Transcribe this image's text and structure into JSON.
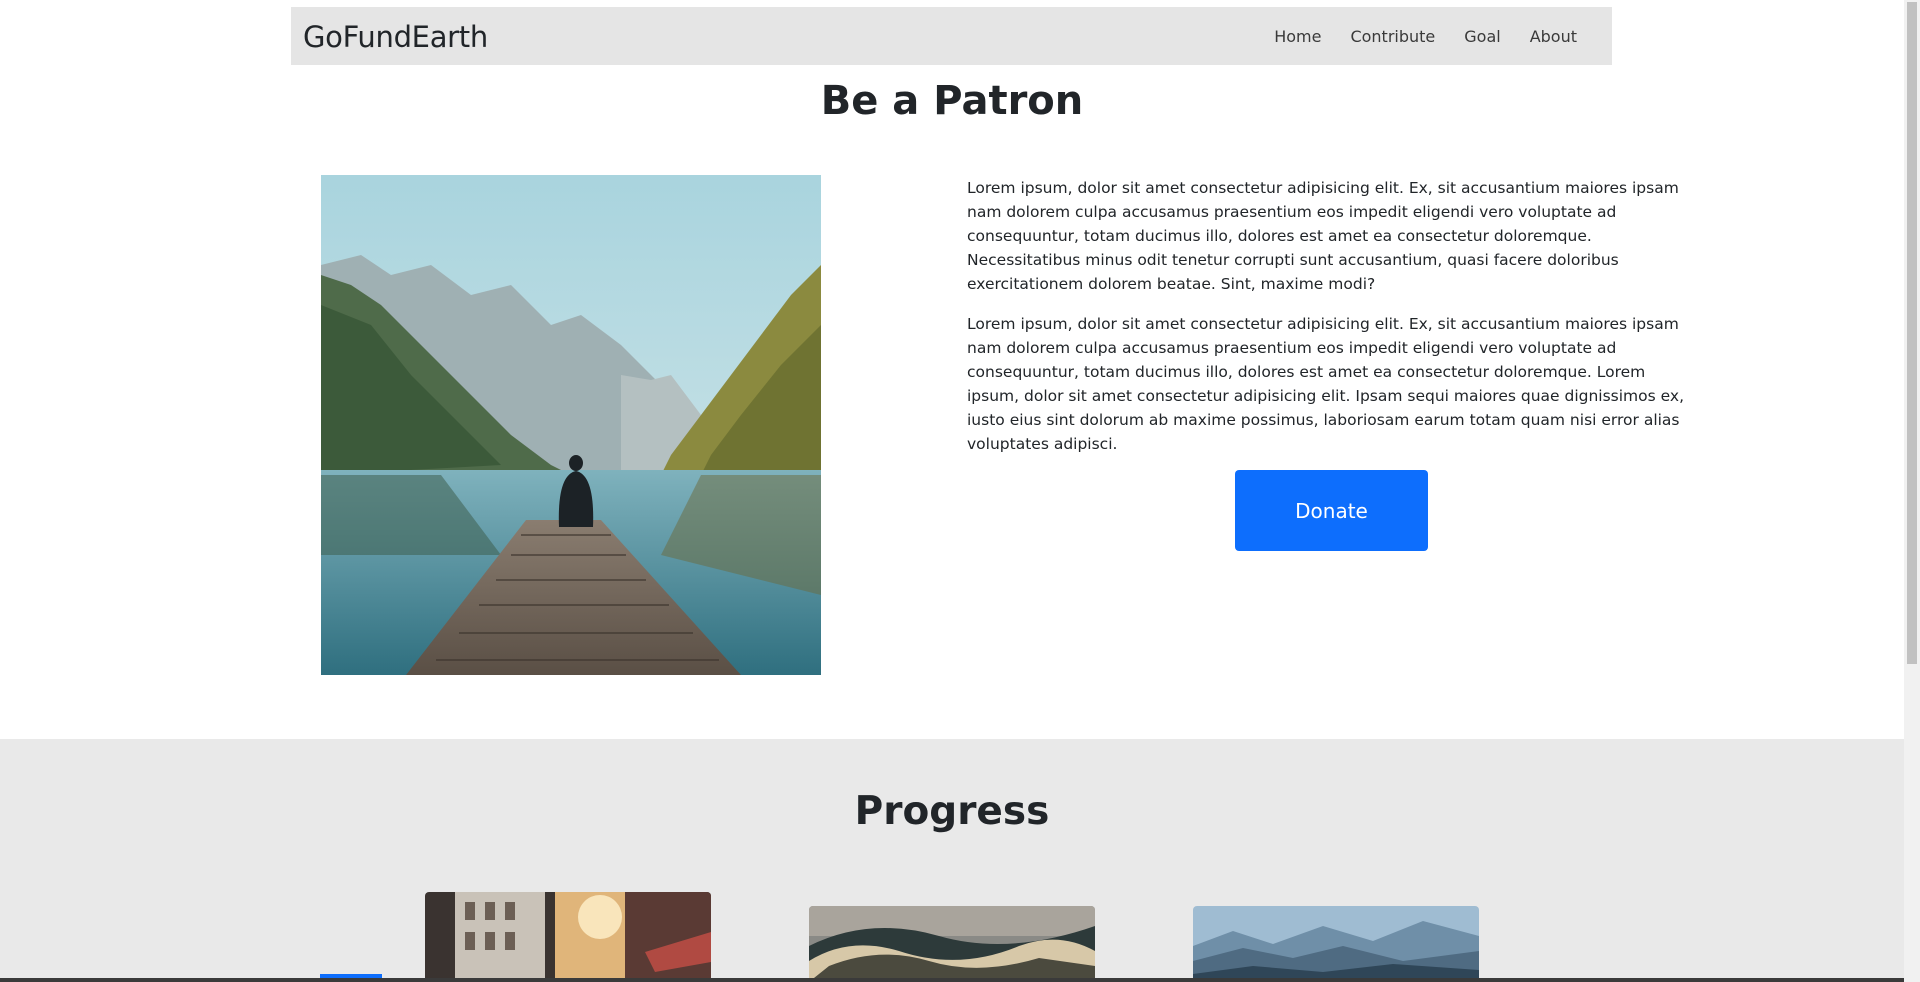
{
  "navbar": {
    "brand": "GoFundEarth",
    "links": [
      "Home",
      "Contribute",
      "Goal",
      "About"
    ]
  },
  "patron": {
    "title": "Be a Patron",
    "paragraph_1": "Lorem ipsum, dolor sit amet consectetur adipisicing elit. Ex, sit accusantium maiores ipsam nam dolorem culpa accusamus praesentium eos impedit eligendi vero voluptate ad consequuntur, totam ducimus illo, dolores est amet ea consectetur doloremque. Necessitatibus minus odit tenetur corrupti sunt accusantium, quasi facere doloribus exercitationem dolorem beatae. Sint, maxime modi?",
    "paragraph_2": "Lorem ipsum, dolor sit amet consectetur adipisicing elit. Ex, sit accusantium maiores ipsam nam dolorem culpa accusamus praesentium eos impedit eligendi vero voluptate ad consequuntur, totam ducimus illo, dolores est amet ea consectetur doloremque. Lorem ipsum, dolor sit amet consectetur adipisicing elit. Ipsam sequi maiores quae dignissimos ex, iusto eius sint dolorum ab maxime possimus, laboriosam earum totam quam nisi error alias voluptates adipisci.",
    "donate_label": "Donate"
  },
  "progress": {
    "title": "Progress"
  },
  "colors": {
    "primary": "#0d6efd",
    "navbar_bg": "#e5e5e5",
    "section_bg": "#e9e9e9"
  }
}
